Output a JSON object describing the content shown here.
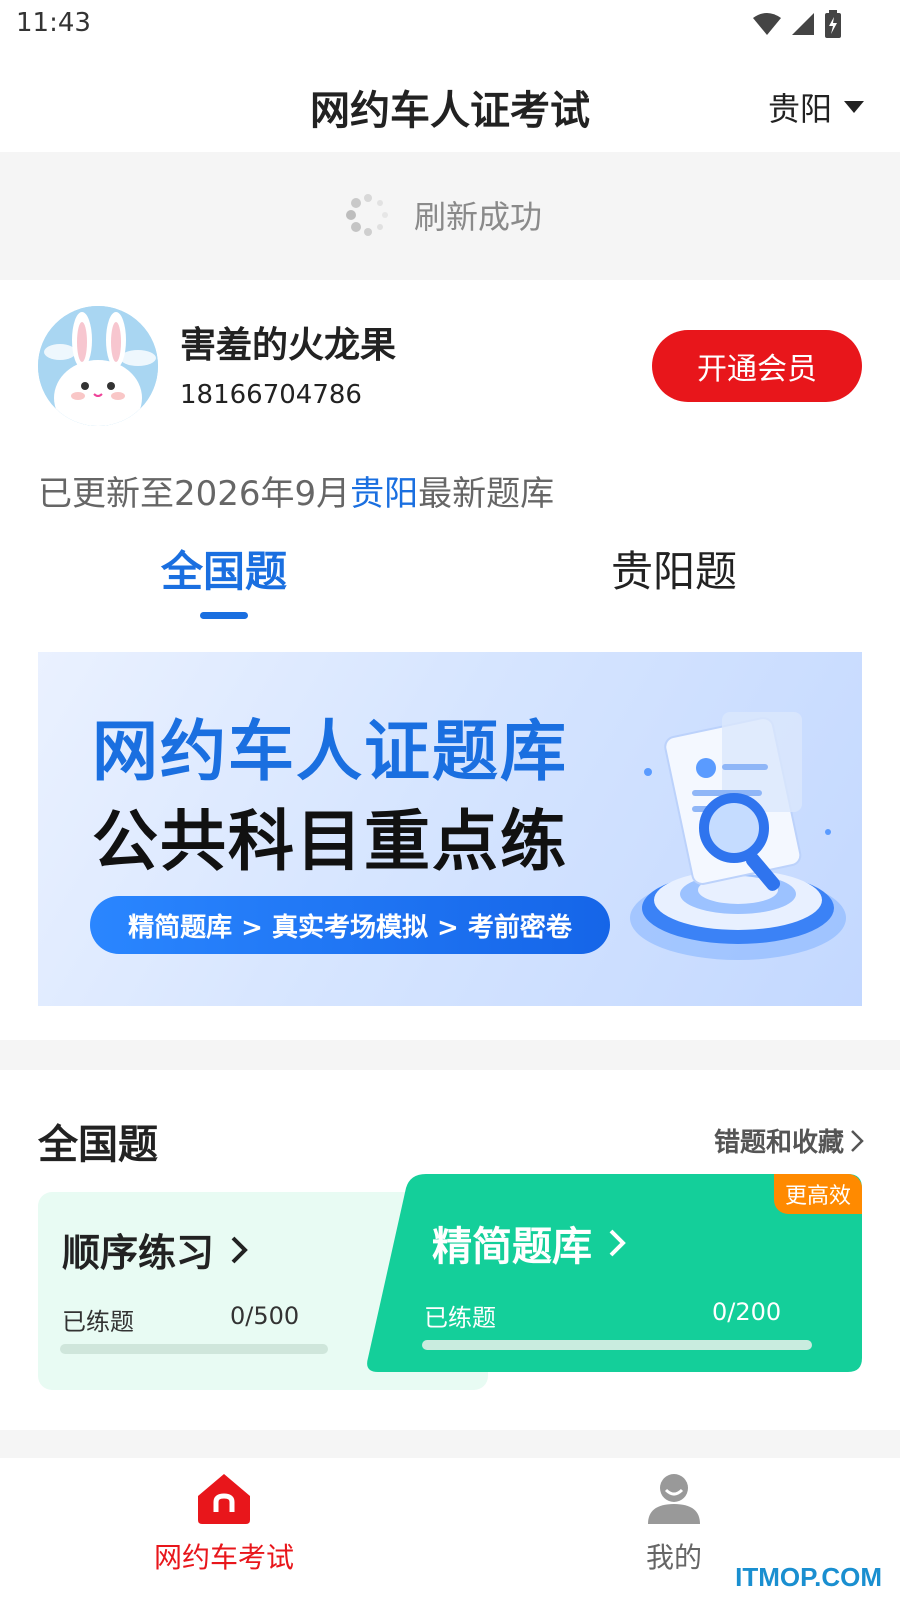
{
  "status_bar": {
    "time": "11:43"
  },
  "header": {
    "title": "网约车人证考试",
    "city": "贵阳"
  },
  "refresh": {
    "text": "刷新成功"
  },
  "profile": {
    "name": "害羞的火龙果",
    "phone": "18166704786",
    "vip_button": "开通会员",
    "update_prefix": "已更新至2026年9月",
    "update_city": "贵阳",
    "update_suffix": "最新题库"
  },
  "tabs": [
    {
      "label": "全国题",
      "active": true
    },
    {
      "label": "贵阳题",
      "active": false
    }
  ],
  "banner": {
    "line1": "网约车人证题库",
    "line2": "公共科目重点练",
    "pill": "精简题库 > 真实考场模拟 > 考前密卷"
  },
  "practice": {
    "section_title": "全国题",
    "wrong_link": "错题和收藏",
    "sequential": {
      "title": "顺序练习",
      "practiced_label": "已练题",
      "count": "0/500",
      "progress": 0
    },
    "brief": {
      "title": "精简题库",
      "badge": "更高效",
      "practiced_label": "已练题",
      "count": "0/200",
      "progress": 0
    }
  },
  "tabbar": [
    {
      "label": "网约车考试",
      "icon": "home-icon",
      "active": true
    },
    {
      "label": "我的",
      "icon": "person-icon",
      "active": false
    }
  ],
  "watermark": "ITMOP.COM",
  "colors": {
    "primary_blue": "#1a6fe0",
    "accent_red": "#e8161b",
    "brief_green": "#14cf9a",
    "badge_orange": "#ff8a00"
  }
}
